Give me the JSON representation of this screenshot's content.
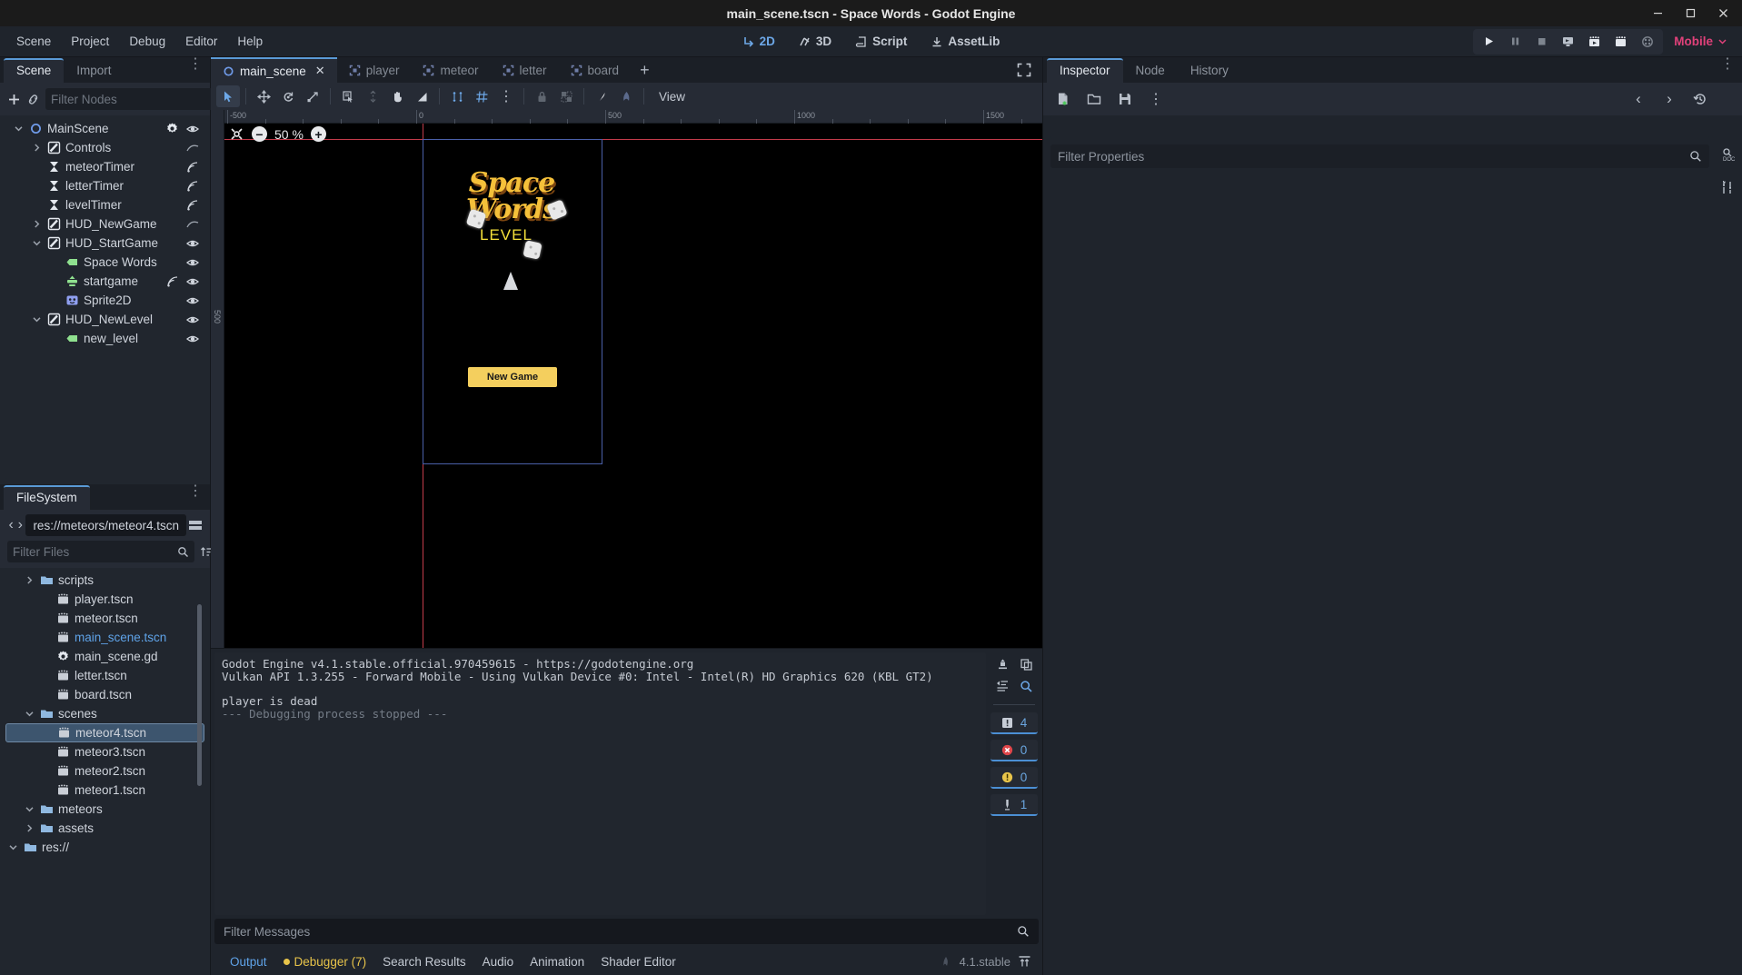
{
  "window": {
    "title": "main_scene.tscn - Space Words - Godot Engine",
    "minimize": "–",
    "maximize": "□",
    "close": "✕"
  },
  "menubar": {
    "items": [
      "Scene",
      "Project",
      "Debug",
      "Editor",
      "Help"
    ],
    "modes": [
      {
        "label": "2D",
        "icon": "2d-icon",
        "active": true
      },
      {
        "label": "3D",
        "icon": "3d-icon",
        "active": false
      },
      {
        "label": "Script",
        "icon": "script-icon",
        "active": false
      },
      {
        "label": "AssetLib",
        "icon": "assetlib-icon",
        "active": false
      }
    ],
    "play_controls": [
      "play-icon",
      "pause-icon",
      "stop-icon",
      "run-remote-debug-icon",
      "play-scene-icon",
      "play-custom-scene-icon",
      "movie-writer-icon"
    ],
    "renderer": "Mobile",
    "renderer_caret": "⌄"
  },
  "scene_dock": {
    "tabs": [
      {
        "label": "Scene",
        "active": true
      },
      {
        "label": "Import",
        "active": false
      }
    ],
    "toolbar": {
      "add_label": "+",
      "link_label": "link-icon",
      "menu_label": "⋮"
    },
    "filter_placeholder": "Filter Nodes",
    "filter_value": "",
    "nodes": [
      {
        "label": "MainScene",
        "depth": 0,
        "twisty": "open",
        "icon": "node2d",
        "icon_color": "#6f9ae8",
        "script": true,
        "signal": false,
        "visible": true
      },
      {
        "label": "Controls",
        "depth": 1,
        "twisty": "closed",
        "icon": "script-node",
        "icon_color": "#e4e8ee",
        "script": false,
        "signal": false,
        "visible": false,
        "curve": true
      },
      {
        "label": "meteorTimer",
        "depth": 1,
        "twisty": "none",
        "icon": "timer",
        "icon_color": "#e4e8ee",
        "script": false,
        "signal": true,
        "visible": false
      },
      {
        "label": "letterTimer",
        "depth": 1,
        "twisty": "none",
        "icon": "timer",
        "icon_color": "#e4e8ee",
        "script": false,
        "signal": true,
        "visible": false
      },
      {
        "label": "levelTimer",
        "depth": 1,
        "twisty": "none",
        "icon": "timer",
        "icon_color": "#e4e8ee",
        "script": false,
        "signal": true,
        "visible": false
      },
      {
        "label": "HUD_NewGame",
        "depth": 1,
        "twisty": "closed",
        "icon": "script-node",
        "icon_color": "#e4e8ee",
        "script": false,
        "signal": false,
        "visible": false,
        "curve": true
      },
      {
        "label": "HUD_StartGame",
        "depth": 1,
        "twisty": "open",
        "icon": "script-node",
        "icon_color": "#e4e8ee",
        "script": false,
        "signal": false,
        "visible": true
      },
      {
        "label": "Space Words",
        "depth": 2,
        "twisty": "none",
        "icon": "label",
        "icon_color": "#8fe08f",
        "script": false,
        "signal": false,
        "visible": true
      },
      {
        "label": "startgame",
        "depth": 2,
        "twisty": "none",
        "icon": "button",
        "icon_color": "#8fe08f",
        "script": false,
        "signal": true,
        "visible": true
      },
      {
        "label": "Sprite2D",
        "depth": 2,
        "twisty": "none",
        "icon": "sprite",
        "icon_color": "#8f9ff0",
        "script": false,
        "signal": false,
        "visible": true
      },
      {
        "label": "HUD_NewLevel",
        "depth": 1,
        "twisty": "open",
        "icon": "script-node",
        "icon_color": "#e4e8ee",
        "script": false,
        "signal": false,
        "visible": true
      },
      {
        "label": "new_level",
        "depth": 2,
        "twisty": "none",
        "icon": "label",
        "icon_color": "#8fe08f",
        "script": false,
        "signal": false,
        "visible": true
      }
    ]
  },
  "filesystem_dock": {
    "tab": "FileSystem",
    "menu": "⋮",
    "nav_back": "‹",
    "nav_forward": "›",
    "path": "res://meteors/meteor4.tscn",
    "filter_placeholder": "Filter Files",
    "filter_value": "",
    "files": [
      {
        "label": "res://",
        "depth": 0,
        "twisty": "open",
        "type": "folder",
        "selected": false,
        "highlight": false
      },
      {
        "label": "assets",
        "depth": 1,
        "twisty": "closed",
        "type": "folder",
        "selected": false,
        "highlight": false
      },
      {
        "label": "meteors",
        "depth": 1,
        "twisty": "open",
        "type": "folder",
        "selected": false,
        "highlight": false
      },
      {
        "label": "meteor1.tscn",
        "depth": 2,
        "twisty": "none",
        "type": "scene",
        "selected": false,
        "highlight": false
      },
      {
        "label": "meteor2.tscn",
        "depth": 2,
        "twisty": "none",
        "type": "scene",
        "selected": false,
        "highlight": false
      },
      {
        "label": "meteor3.tscn",
        "depth": 2,
        "twisty": "none",
        "type": "scene",
        "selected": false,
        "highlight": false
      },
      {
        "label": "meteor4.tscn",
        "depth": 2,
        "twisty": "none",
        "type": "scene",
        "selected": true,
        "highlight": false
      },
      {
        "label": "scenes",
        "depth": 1,
        "twisty": "open",
        "type": "folder",
        "selected": false,
        "highlight": false
      },
      {
        "label": "board.tscn",
        "depth": 2,
        "twisty": "none",
        "type": "scene",
        "selected": false,
        "highlight": false
      },
      {
        "label": "letter.tscn",
        "depth": 2,
        "twisty": "none",
        "type": "scene",
        "selected": false,
        "highlight": false
      },
      {
        "label": "main_scene.gd",
        "depth": 2,
        "twisty": "none",
        "type": "script",
        "selected": false,
        "highlight": false
      },
      {
        "label": "main_scene.tscn",
        "depth": 2,
        "twisty": "none",
        "type": "scene",
        "selected": false,
        "highlight": true
      },
      {
        "label": "meteor.tscn",
        "depth": 2,
        "twisty": "none",
        "type": "scene",
        "selected": false,
        "highlight": false
      },
      {
        "label": "player.tscn",
        "depth": 2,
        "twisty": "none",
        "type": "scene",
        "selected": false,
        "highlight": false
      },
      {
        "label": "scripts",
        "depth": 1,
        "twisty": "closed",
        "type": "folder",
        "selected": false,
        "highlight": false
      }
    ]
  },
  "editor": {
    "scene_tabs": [
      {
        "label": "main_scene",
        "active": true,
        "icon": "node2d-icon",
        "close": "✕"
      },
      {
        "label": "player",
        "active": false,
        "icon": "scene-icon"
      },
      {
        "label": "meteor",
        "active": false,
        "icon": "scene-icon"
      },
      {
        "label": "letter",
        "active": false,
        "icon": "scene-icon"
      },
      {
        "label": "board",
        "active": false,
        "icon": "scene-icon"
      }
    ],
    "tab_add": "+",
    "fullscreen": "expand-icon",
    "canvas_toolbar": {
      "tools": [
        "select-mode-icon",
        "move-mode-icon",
        "rotate-mode-icon",
        "scale-mode-icon",
        "list-select-icon",
        "ruler-mode-icon",
        "pan-mode-icon",
        "anchor-mode-icon",
        "snap-mode-icon",
        "grid-snap-icon",
        "snap-options-icon",
        "lock-icon",
        "group-icon",
        "skeleton-icon",
        "bone-icon"
      ],
      "view_label": "View"
    },
    "viewport": {
      "zoom_reset_icon": "zoom-reset-icon",
      "zoom_out": "−",
      "zoom_in": "+",
      "zoom_level": "50 %",
      "ruler_labels_h": [
        "-500",
        "0",
        "500",
        "1000",
        "1500"
      ],
      "ruler_label_v": "500"
    },
    "game": {
      "title_line1": "Space",
      "title_line2": "Words",
      "level_label": "LEVEL",
      "button_label": "New Game"
    }
  },
  "output": {
    "lines": [
      {
        "text": "Godot Engine v4.1.stable.official.970459615 - https://godotengine.org",
        "dim": false
      },
      {
        "text": "Vulkan API 1.3.255 - Forward Mobile - Using Vulkan Device #0: Intel - Intel(R) HD Graphics 620 (KBL GT2)",
        "dim": false
      },
      {
        "text": "",
        "dim": false
      },
      {
        "text": "player is dead",
        "dim": false
      },
      {
        "text": "--- Debugging process stopped ---",
        "dim": true
      }
    ],
    "side_icons": [
      "clear-output-icon",
      "copy-icon",
      "collapse-icon",
      "search-icon"
    ],
    "counters": [
      {
        "icon": "message-icon",
        "count": "4",
        "color": "#c6ccd6"
      },
      {
        "icon": "error-icon",
        "count": "0",
        "color": "#e0464a"
      },
      {
        "icon": "warning-icon",
        "count": "0",
        "color": "#e8c44a"
      },
      {
        "icon": "editor-icon",
        "count": "1",
        "color": "#c6ccd6"
      }
    ],
    "filter_placeholder": "Filter Messages",
    "filter_value": "",
    "tabs": [
      {
        "label": "Output",
        "active": true,
        "warn": false,
        "dot": false
      },
      {
        "label": "Debugger (7)",
        "active": false,
        "warn": true,
        "dot": true
      },
      {
        "label": "Search Results",
        "active": false,
        "warn": false,
        "dot": false
      },
      {
        "label": "Audio",
        "active": false,
        "warn": false,
        "dot": false
      },
      {
        "label": "Animation",
        "active": false,
        "warn": false,
        "dot": false
      },
      {
        "label": "Shader Editor",
        "active": false,
        "warn": false,
        "dot": false
      }
    ],
    "version": "4.1.stable",
    "status_icon": "network-icon",
    "expand_icon": "expand-bottom-icon"
  },
  "inspector": {
    "tabs": [
      {
        "label": "Inspector",
        "active": true
      },
      {
        "label": "Node",
        "active": false
      },
      {
        "label": "History",
        "active": false
      }
    ],
    "menu": "⋮",
    "toolbar_icons": [
      "new-resource-icon",
      "open-resource-icon",
      "save-resource-icon",
      "resource-menu-icon"
    ],
    "nav_prev": "‹",
    "nav_next": "›",
    "history_icon": "history-icon",
    "doc_icon": "doc-search-icon",
    "tools_icon": "object-tools-icon",
    "filter_placeholder": "Filter Properties",
    "filter_value": ""
  },
  "colors": {
    "accent": "#5a9ad6",
    "bg_dark": "#1b1f26",
    "bg_panel": "#21262e",
    "bg_toolbar": "#262b35",
    "text": "#c7ccd4",
    "text_dim": "#8d949e",
    "renderer": "#e0417a",
    "selection": "#3d556e",
    "warn": "#e8c44a",
    "error": "#e0464a"
  }
}
